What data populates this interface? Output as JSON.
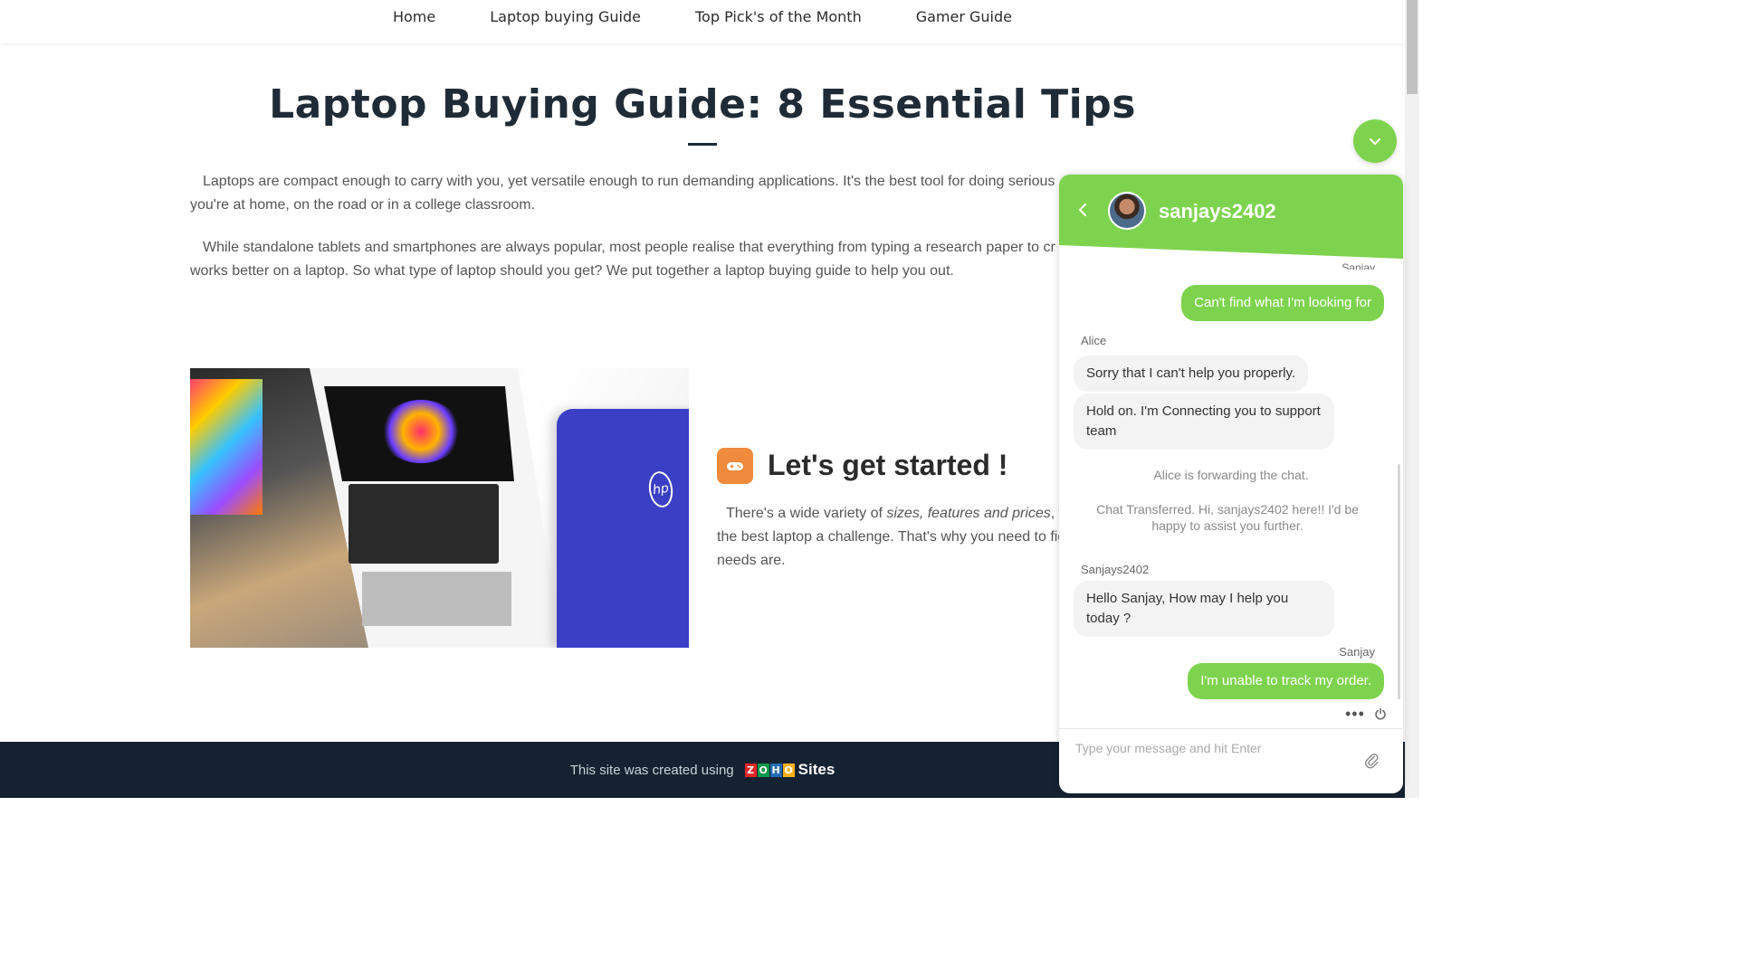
{
  "nav": {
    "items": [
      "Home",
      "Laptop buying Guide",
      "Top Pick's of the Month",
      "Gamer Guide"
    ]
  },
  "article": {
    "title": "Laptop Buying Guide: 8 Essential Tips",
    "para1_line1": "Laptops are compact enough to carry with you, yet versatile enough to run demanding applications. It's the best tool for doing serious",
    "para1_line2": "you're at home, on the road or in a college classroom.",
    "para2_line1": "While standalone tablets and smartphones are always popular, most people realise that everything from typing a research paper to cr",
    "para2_line2": "works better on a laptop. So what type of laptop should you get? We put together a laptop buying guide to help you out."
  },
  "section": {
    "icon": "gamepad-icon",
    "title": "Let's get started !",
    "line1_a": "There's a wide variety of ",
    "line1_em": "sizes, features and prices",
    "line1_b": ", w",
    "line2": "the best laptop a challenge. That's why you need to fig",
    "line3": "needs are."
  },
  "footer": {
    "text": "This site was created using",
    "zoho_letters": [
      "Z",
      "O",
      "H",
      "O"
    ],
    "zoho_colors": [
      "#e42527",
      "#089949",
      "#226db4",
      "#f9b21d"
    ],
    "sites": "Sites"
  },
  "chat": {
    "agent_name": "sanjays2402",
    "input_placeholder": "Type your message and hit Enter",
    "messages": {
      "top_sender": "Sanjay",
      "msg1": "Can't find what I'm looking for",
      "sender_alice": "Alice",
      "msg2": "Sorry that I can't help you properly.",
      "msg3": "Hold on. I'm Connecting you to support team",
      "sys1": "Alice is forwarding the chat.",
      "sys2": "Chat Transferred. Hi, sanjays2402 here!! I'd be happy to assist you further.",
      "sender_agent": "Sanjays2402",
      "msg4": "Hello Sanjay, How may I help you today ?",
      "sender_sanjay": "Sanjay",
      "msg5": "I'm unable to track my order."
    }
  },
  "colors": {
    "accent_green": "#7ed34e",
    "footer_bg": "#152231",
    "section_icon_bg": "#f08a3c"
  }
}
